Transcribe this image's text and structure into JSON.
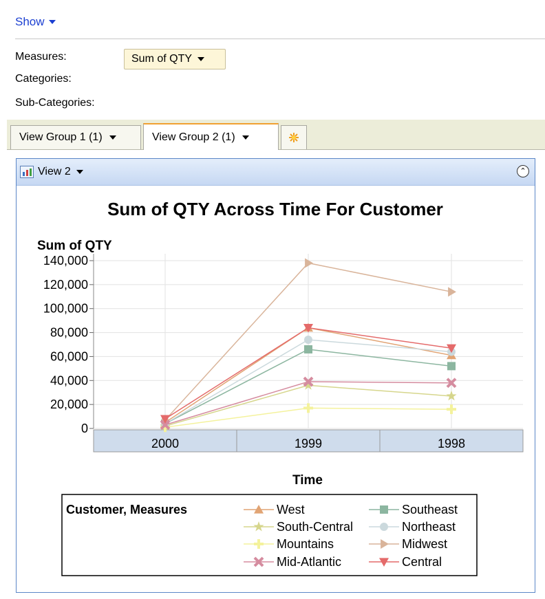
{
  "toolbar": {
    "show_label": "Show"
  },
  "fields": {
    "measures_label": "Measures:",
    "measures_value": "Sum of QTY",
    "categories_label": "Categories:",
    "subcategories_label": "Sub-Categories:"
  },
  "tabs": [
    {
      "label": "View Group 1 (1)",
      "active": false
    },
    {
      "label": "View Group 2 (1)",
      "active": true
    }
  ],
  "view": {
    "title": "View 2"
  },
  "chart_data": {
    "type": "line",
    "title": "Sum of QTY Across Time For Customer",
    "ylabel": "Sum of QTY",
    "xlabel": "Time",
    "categories": [
      "2000",
      "1999",
      "1998"
    ],
    "ylim": [
      0,
      140000
    ],
    "yticks": [
      0,
      20000,
      40000,
      60000,
      80000,
      100000,
      120000,
      140000
    ],
    "ytick_labels": [
      "0",
      "20,000",
      "40,000",
      "60,000",
      "80,000",
      "100,000",
      "120,000",
      "140,000"
    ],
    "grid": true,
    "legend_title": "Customer,  Measures",
    "legend_position": "bottom",
    "series": [
      {
        "name": "West",
        "values": [
          5000,
          84000,
          61000
        ],
        "color": "#e1a474",
        "marker": "triangle-up"
      },
      {
        "name": "Southeast",
        "values": [
          4000,
          66000,
          52000
        ],
        "color": "#8cb6a0",
        "marker": "square"
      },
      {
        "name": "South-Central",
        "values": [
          2000,
          36000,
          27000
        ],
        "color": "#d6d68c",
        "marker": "star"
      },
      {
        "name": "Northeast",
        "values": [
          4000,
          74000,
          64000
        ],
        "color": "#cbd9dd",
        "marker": "circle"
      },
      {
        "name": "Mountains",
        "values": [
          1000,
          17000,
          16000
        ],
        "color": "#f4f29c",
        "marker": "plus"
      },
      {
        "name": "Midwest",
        "values": [
          7000,
          138000,
          114000
        ],
        "color": "#d9b49a",
        "marker": "triangle-right"
      },
      {
        "name": "Mid-Atlantic",
        "values": [
          3000,
          39000,
          38000
        ],
        "color": "#d58c9f",
        "marker": "x"
      },
      {
        "name": "Central",
        "values": [
          8000,
          84000,
          67000
        ],
        "color": "#e46a6a",
        "marker": "triangle-down"
      }
    ]
  }
}
